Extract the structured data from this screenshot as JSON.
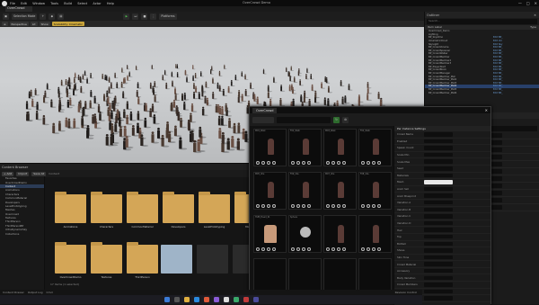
{
  "window": {
    "title": "OverCrowd Demo",
    "menu": [
      "File",
      "Edit",
      "Window",
      "Tools",
      "Build",
      "Select",
      "Actor",
      "Help"
    ],
    "level_tab": "OverCrowd",
    "controls": [
      "—",
      "□",
      "✕"
    ]
  },
  "toolbar": {
    "mode_label": "Selection Mode",
    "platforms_label": "Platforms"
  },
  "viewport": {
    "perspective_label": "Perspective",
    "lit_label": "Lit",
    "show_label": "Show",
    "scalability_label": "Scalability: Cinematic"
  },
  "outliner": {
    "tab_label": "Outliner",
    "search_placeholder": "Search...",
    "col_label": "Item Label",
    "col_type": "Type",
    "rows": [
      {
        "name": "OverCrowd_Demo",
        "type": ""
      },
      {
        "name": "Lighting",
        "type": ""
      },
      {
        "name": "BP_SkyAtmo",
        "type": "Edit BP_"
      },
      {
        "name": "VolumetricCloud",
        "type": "Edit Vol"
      },
      {
        "name": "SkyLight",
        "type": "Edit Sky"
      },
      {
        "name": "BP_CrowdVolume",
        "type": "Edit BP_"
      },
      {
        "name": "BP_CrowdSpawner",
        "type": "Edit BP_"
      },
      {
        "name": "BP_CrowdWalker",
        "type": "Edit BP_"
      },
      {
        "name": "BP_CrowdMember",
        "type": "Edit BP_"
      },
      {
        "name": "BP_CrowdMember2",
        "type": "Edit BP_"
      },
      {
        "name": "BP_CrowdMember3",
        "type": "Edit BP_"
      },
      {
        "name": "BP_PlayerStart",
        "type": "Edit BP_"
      },
      {
        "name": "BP_CrowdBlock",
        "type": "Edit BP_"
      },
      {
        "name": "BP_CrowdManager",
        "type": "Edit BP_"
      },
      {
        "name": "BP_CrowdMember_Mat",
        "type": "Edit BP_"
      },
      {
        "name": "BP_CrowdMember_Mat2",
        "type": "Edit BP_"
      },
      {
        "name": "BP_CrowdMember_Mat3",
        "type": "Edit BP_"
      },
      {
        "name": "BP_CrowdMember_Mat4",
        "type": "Edit BP_"
      },
      {
        "name": "BP_CrowdMember_Mat5",
        "type": "Edit BP_"
      },
      {
        "name": "BP_CrowdMember_Mat6",
        "type": "Edit BP_"
      }
    ],
    "selected_index": 17
  },
  "details": {
    "tab_label": "Details",
    "actor_name": "BP_CrowdMember_Mat",
    "rows": [
      "Location",
      "Rotation",
      "Scale",
      "Mobility",
      "Crowd Volume",
      "Spawn Count",
      "Anim Set",
      "Materials",
      "Seed",
      "Rendering",
      "LOD"
    ]
  },
  "content_browser": {
    "tab_label": "Content Browser",
    "add_label": "+ Add",
    "import_label": "Import",
    "save_label": "Save All",
    "path_label": "Content",
    "tree": [
      "Favorites",
      "OverCrowdDemo",
      "Content",
      "Animations",
      "Characters",
      "CommonMaterial",
      "Developers",
      "LevelPrototyping",
      "Meshes",
      "Overcrowd",
      "Textures",
      "ThirdPerson",
      "ThirdPersonBP",
      "UltraDynamicSky",
      "Collections"
    ],
    "tree_selected": 2,
    "folders_row1": [
      "Animations",
      "Characters",
      "CommonMaterial",
      "Developers",
      "LevelPrototyping",
      "Meshes"
    ],
    "folders_row2": [
      "OverCrowdDemo",
      "Textures",
      "ThirdPerson"
    ],
    "items_count": "17 items (1 selected)",
    "collections_label": "Collections"
  },
  "overcrowd": {
    "tab_label": "OverCrowd",
    "props_header": "Per Instance Settings",
    "prop_rows": [
      "Crowd Name",
      "Enabled",
      "Spawn Count",
      "Scale Min",
      "Scale Max",
      "Seed",
      "Materials",
      "Mesh",
      "Anim Set",
      "Anim Blueprint",
      "Variation A",
      "Variation B",
      "Variation C",
      "Variation D",
      "Hair",
      "Top",
      "Bottom",
      "Shoes",
      "Skin Tone",
      "Crowd Material",
      "Accessory",
      "Body Variation",
      "Crowd Members",
      "Speed",
      "Rotation"
    ],
    "cells_row1": [
      "M01_Walk",
      "F02_Walk",
      "M03_Walk",
      "F04_Walk"
    ],
    "cells_row2": [
      "M05_Idle",
      "F06_Idle",
      "M07_Idle",
      "F08_Idle"
    ],
    "cells_row3": [
      "HUM_Head_01",
      "Sphere",
      "",
      ""
    ],
    "cells_row4": [
      "",
      "",
      "",
      ""
    ]
  },
  "status": {
    "cmd_label": "Cmd",
    "drawer_label": "Content Drawer",
    "output_label": "Output Log",
    "revision_label": "Revision Control"
  },
  "colors": {
    "accent_blue": "#28406a",
    "folder": "#d4a657",
    "highlight": "#c9a43a"
  }
}
